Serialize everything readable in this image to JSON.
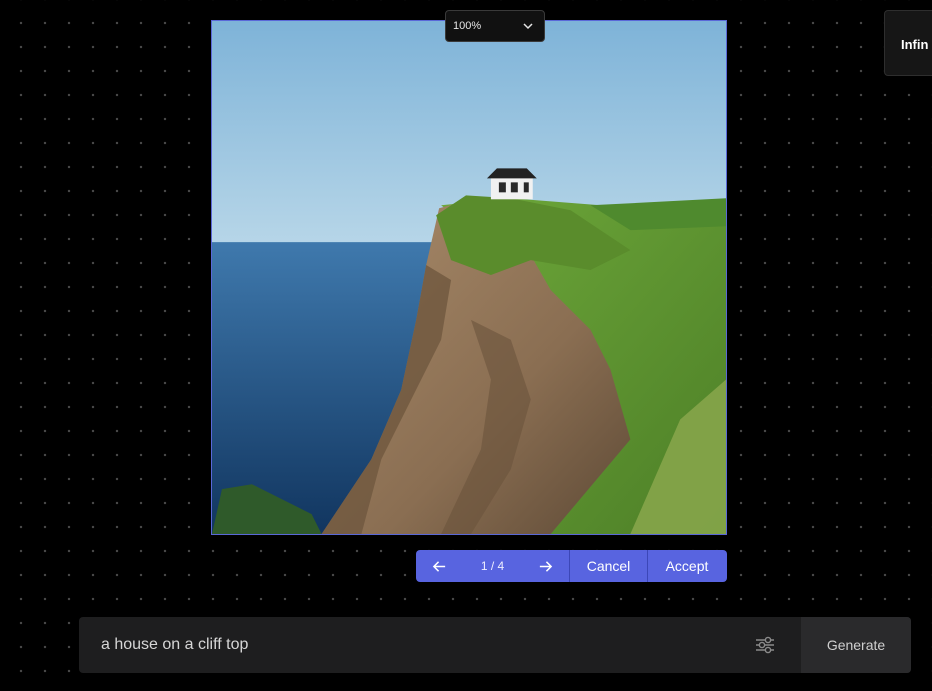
{
  "zoom": {
    "value": "100%"
  },
  "panel": {
    "title": "Infin"
  },
  "result_controls": {
    "page_indicator": "1 / 4",
    "cancel_label": "Cancel",
    "accept_label": "Accept"
  },
  "prompt": {
    "value": "a house on a cliff top",
    "generate_label": "Generate"
  },
  "icons": {
    "zoom_dropdown": "chevron-down-icon",
    "previous": "arrow-left-icon",
    "next": "arrow-right-icon",
    "settings": "sliders-icon"
  },
  "colors": {
    "accent": "#5864e0",
    "background": "#000000",
    "prompt_bar": "#1e1e1f"
  }
}
